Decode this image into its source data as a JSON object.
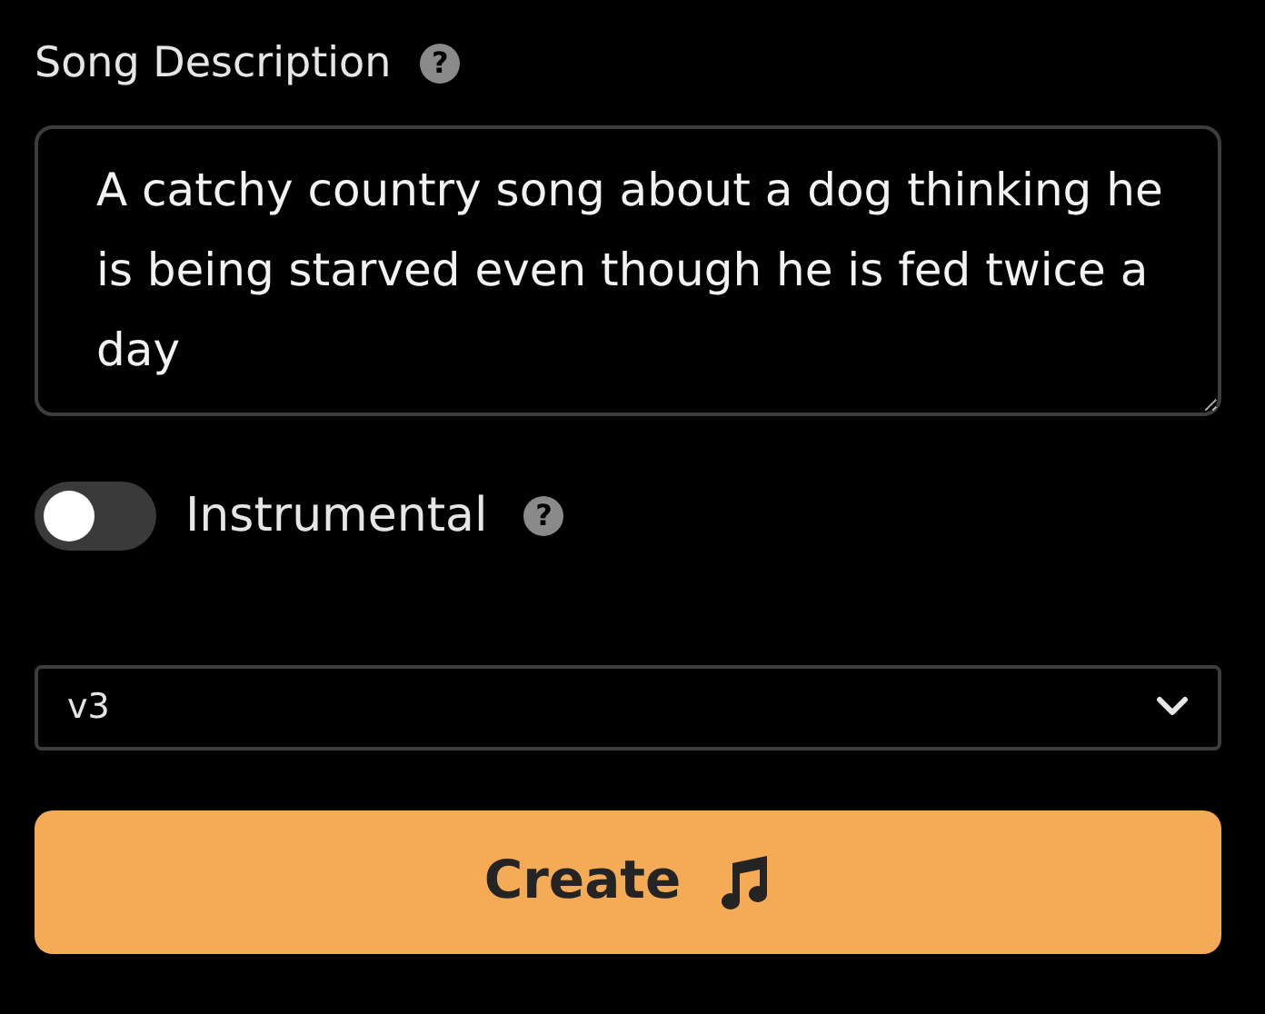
{
  "description": {
    "label": "Song Description",
    "help": "?",
    "value": "A catchy country song about a dog thinking he is being starved even though he is fed twice a day"
  },
  "instrumental": {
    "label": "Instrumental",
    "on": false,
    "help": "?"
  },
  "model_select": {
    "value": "v3"
  },
  "create_button": {
    "label": "Create"
  }
}
